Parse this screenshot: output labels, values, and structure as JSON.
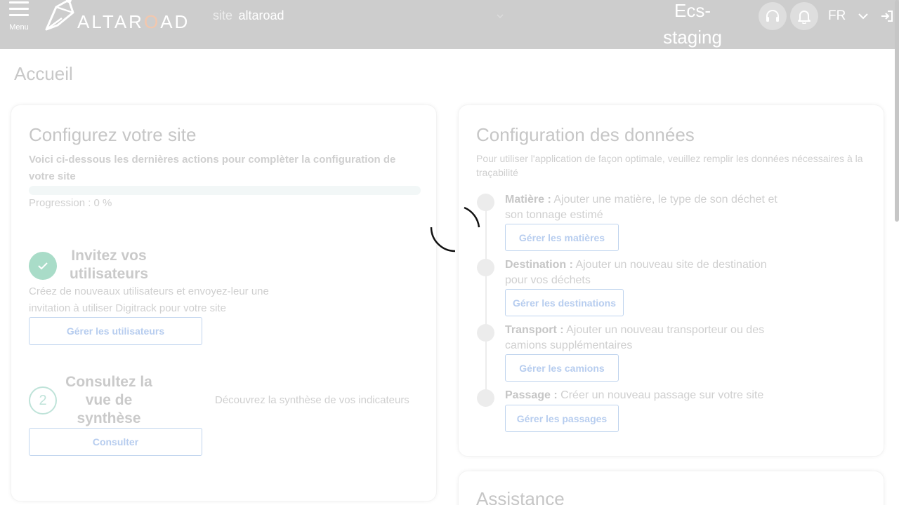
{
  "header": {
    "menu_label": "Menu",
    "logo_text_pre": "ALTAR",
    "logo_text_o": "O",
    "logo_text_post": "AD",
    "site_prefix": "site",
    "site_value": "altaroad",
    "env_line1": "Ecs-",
    "env_line2": "staging",
    "lang": "FR"
  },
  "page": {
    "title": "Accueil"
  },
  "setup_card": {
    "title": "Configurez votre site",
    "subtitle": "Voici ci-dessous les dernières actions pour complèter la configuration de votre site",
    "progress_label": "Progression : 0 %",
    "progress_value": 0,
    "step1": {
      "title": "Invitez vos utilisateurs",
      "desc": "Créez de nouveaux utilisateurs et envoyez-leur une invitation à utiliser Digitrack pour votre site",
      "button": "Gérer les utilisateurs"
    },
    "step2": {
      "number": "2",
      "title": "Consultez la vue de synthèse",
      "desc": "Découvrez la synthèse de vos indicateurs",
      "button": "Consulter"
    }
  },
  "data_card": {
    "title": "Configuration des données",
    "intro": "Pour utiliser l'application de façon optimale, veuillez remplir les données nécessaires à la traçabilité",
    "items": [
      {
        "label": "Matière :",
        "text": "Ajouter une matière, le type de son déchet et son tonnage estimé",
        "button": "Gérer les matières"
      },
      {
        "label": "Destination :",
        "text": "Ajouter un nouveau site de destination pour vos déchets",
        "button": "Gérer les destinations"
      },
      {
        "label": "Transport :",
        "text": "Ajouter un nouveau transporteur ou des camions supplémentaires",
        "button": "Gérer les camions"
      },
      {
        "label": "Passage :",
        "text": "Créer un nouveau passage sur votre site",
        "button": "Gérer les passages"
      }
    ]
  },
  "assist_card": {
    "title": "Assistance"
  },
  "icons": {
    "menu": "hamburger-icon",
    "support": "headset-icon",
    "notifications": "bell-icon",
    "logout": "logout-icon",
    "loading": "spinner-icon"
  }
}
